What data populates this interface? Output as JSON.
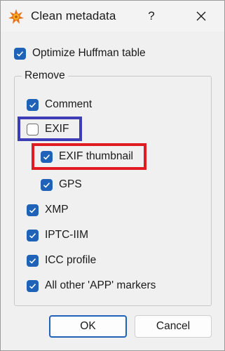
{
  "window": {
    "title": "Clean metadata",
    "help_label": "?",
    "close_label": "✕"
  },
  "options": {
    "optimize_huffman": {
      "label": "Optimize Huffman table",
      "checked": true
    }
  },
  "remove_group": {
    "label": "Remove",
    "items": [
      {
        "label": "Comment",
        "checked": true
      },
      {
        "label": "EXIF",
        "checked": false
      },
      {
        "label": "EXIF thumbnail",
        "checked": true
      },
      {
        "label": "GPS",
        "checked": true
      },
      {
        "label": "XMP",
        "checked": true
      },
      {
        "label": "IPTC-IIM",
        "checked": true
      },
      {
        "label": "ICC profile",
        "checked": true
      },
      {
        "label": "All other 'APP' markers",
        "checked": true
      }
    ]
  },
  "buttons": {
    "ok": "OK",
    "cancel": "Cancel"
  },
  "colors": {
    "accent": "#1e63b8",
    "highlight_blue": "#3d3db8",
    "highlight_red": "#e11b22"
  }
}
